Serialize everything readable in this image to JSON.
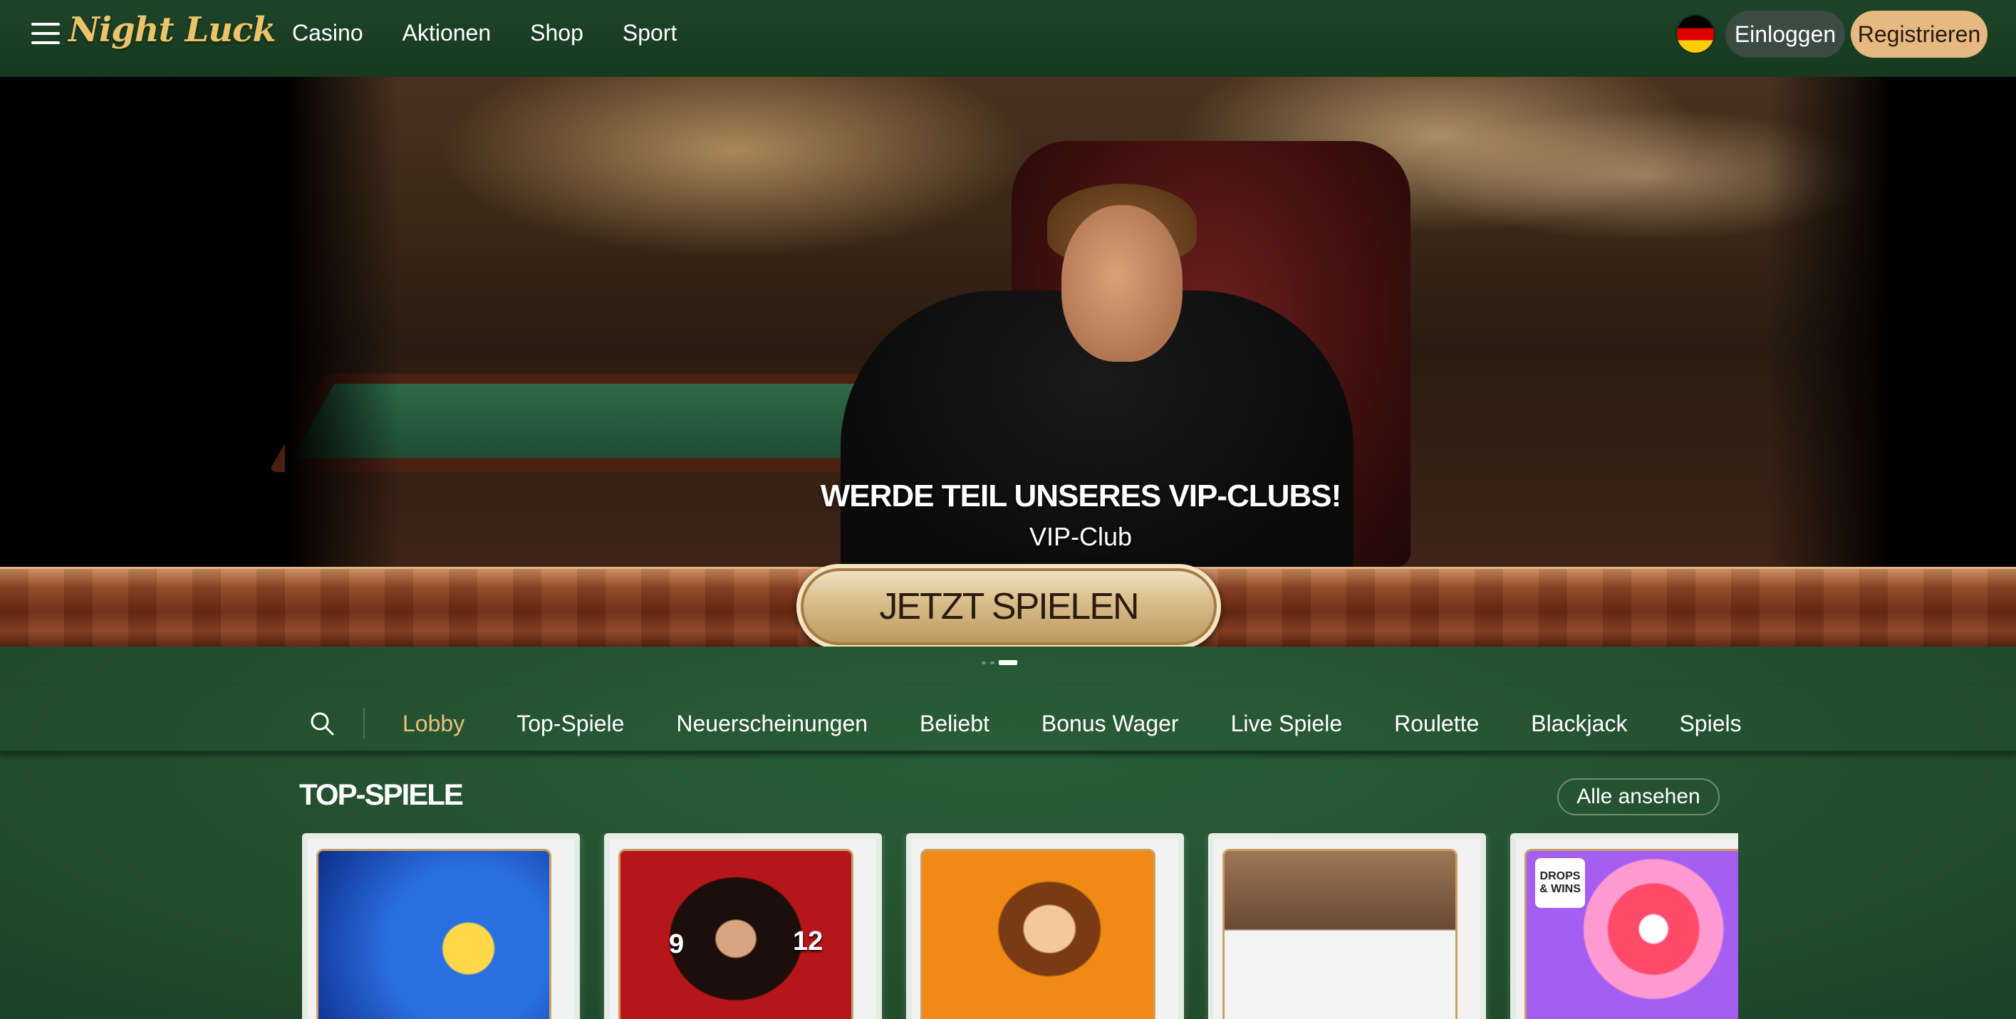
{
  "brand": {
    "name": "Night Luck",
    "color": "#e9c46a"
  },
  "nav": {
    "items": [
      "Casino",
      "Aktionen",
      "Shop",
      "Sport"
    ]
  },
  "header": {
    "language_flag": "de-flag-icon",
    "login_label": "Einloggen",
    "register_label": "Registrieren"
  },
  "hero": {
    "title": "WERDE TEIL UNSERES VIP-CLUBS!",
    "subtitle": "VIP-Club",
    "cta_label": "JETZT SPIELEN",
    "slides_count": 3,
    "active_slide": 3
  },
  "categories": {
    "items": [
      "Lobby",
      "Top-Spiele",
      "Neuerscheinungen",
      "Beliebt",
      "Bonus Wager",
      "Live Spiele",
      "Roulette",
      "Blackjack",
      "Spielshows"
    ],
    "active": "Lobby"
  },
  "top_games": {
    "title": "TOP-SPIELE",
    "see_all_label": "Alle ansehen",
    "cards": [
      {
        "art": "lightning-train-art"
      },
      {
        "art": "roulette-dealer-art",
        "numbers": [
          "9",
          "12"
        ]
      },
      {
        "art": "cowboy-adventurer-art"
      },
      {
        "art": "blackjack-dealer-art"
      },
      {
        "art": "candy-lollipop-art",
        "badge": "DROPS & WINS"
      }
    ]
  },
  "colors": {
    "topbar": "#1d4429",
    "felt": "#234f2f",
    "accent": "#e9c17e",
    "register_button": "#e6b982",
    "login_button": "#3b4a42"
  }
}
